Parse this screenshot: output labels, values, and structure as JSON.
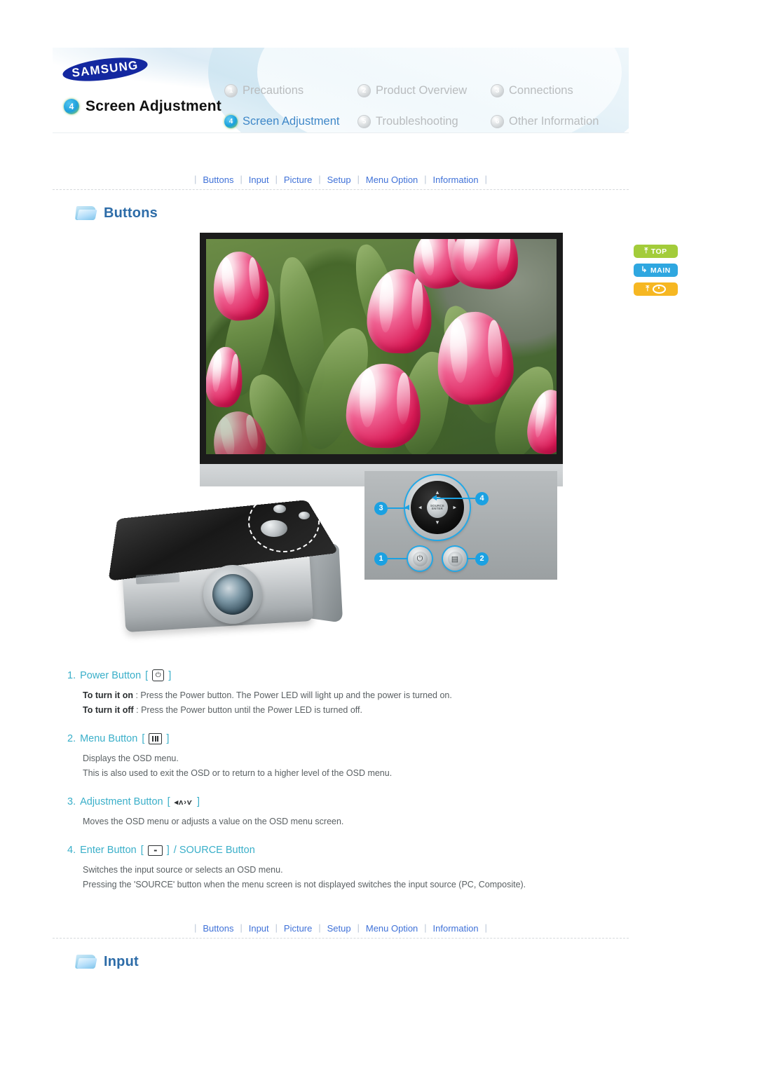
{
  "brand": "SAMSUNG",
  "header": {
    "chapter_number": "4",
    "chapter_title": "Screen Adjustment",
    "nav": [
      {
        "num": "1",
        "label": "Precautions",
        "active": false
      },
      {
        "num": "2",
        "label": "Product Overview",
        "active": false
      },
      {
        "num": "3",
        "label": "Connections",
        "active": false
      },
      {
        "num": "4",
        "label": "Screen Adjustment",
        "active": true
      },
      {
        "num": "5",
        "label": "Troubleshooting",
        "active": false
      },
      {
        "num": "6",
        "label": "Other Information",
        "active": false
      }
    ]
  },
  "tabs": [
    {
      "label": "Buttons"
    },
    {
      "label": "Input"
    },
    {
      "label": "Picture"
    },
    {
      "label": "Setup"
    },
    {
      "label": "Menu Option"
    },
    {
      "label": "Information"
    }
  ],
  "side_buttons": [
    {
      "label": "TOP",
      "icon": "arrow-up-icon",
      "color": "#a3cc3a"
    },
    {
      "label": "MAIN",
      "icon": "arrow-turn-icon",
      "color": "#2fa7e0"
    },
    {
      "label": "",
      "icon": "link-up-icon",
      "color": "#f6b722"
    }
  ],
  "sections": {
    "buttons": {
      "title": "Buttons",
      "icon": "folder-icon"
    },
    "input": {
      "title": "Input",
      "icon": "folder-icon"
    }
  },
  "figure": {
    "projected_image": "tulips-photo",
    "control_panel": {
      "center_label_line1": "SOURCE",
      "center_label_line2": "ENTER",
      "callouts": [
        "1",
        "2",
        "3",
        "4"
      ],
      "arrow_up": "▴",
      "arrow_down": "▾",
      "arrow_left": "◂",
      "arrow_right": "▸",
      "power_glyph": "⏻",
      "menu_glyph": "menu-bars-icon"
    }
  },
  "items": [
    {
      "num": "1.",
      "title": "Power Button",
      "glyph_type": "power",
      "glyph_open": "[",
      "glyph_close": "]",
      "glyph_text": "⏻",
      "lines": [
        {
          "bold": "To turn it on",
          "rest": " : Press the Power button. The Power LED will light up and the power is turned on."
        },
        {
          "bold": "To turn it off",
          "rest": " : Press the Power button until the Power LED is turned off."
        }
      ]
    },
    {
      "num": "2.",
      "title": "Menu Button",
      "glyph_type": "menu",
      "glyph_open": "[",
      "glyph_close": "]",
      "glyph_text": "",
      "lines": [
        {
          "bold": "",
          "rest": "Displays the OSD menu."
        },
        {
          "bold": "",
          "rest": "This is also used to exit the OSD or to return to a higher level of the OSD menu."
        }
      ]
    },
    {
      "num": "3.",
      "title": "Adjustment Button",
      "glyph_type": "arrows",
      "glyph_open": "[",
      "glyph_close": "]",
      "glyph_text": "◂ʌ›ѵ",
      "lines": [
        {
          "bold": "",
          "rest": "Moves the OSD menu or adjusts a value on the OSD menu screen."
        }
      ]
    },
    {
      "num": "4.",
      "title": "Enter Button",
      "title_suffix": " / SOURCE Button",
      "glyph_type": "enter",
      "glyph_open": "[",
      "glyph_close": "]",
      "glyph_text": "▪▪",
      "lines": [
        {
          "bold": "",
          "rest": "Switches the input source or selects an OSD menu."
        },
        {
          "bold": "",
          "rest": "Pressing the 'SOURCE' button when the menu screen is not displayed switches the input source (PC, Composite)."
        }
      ]
    }
  ]
}
